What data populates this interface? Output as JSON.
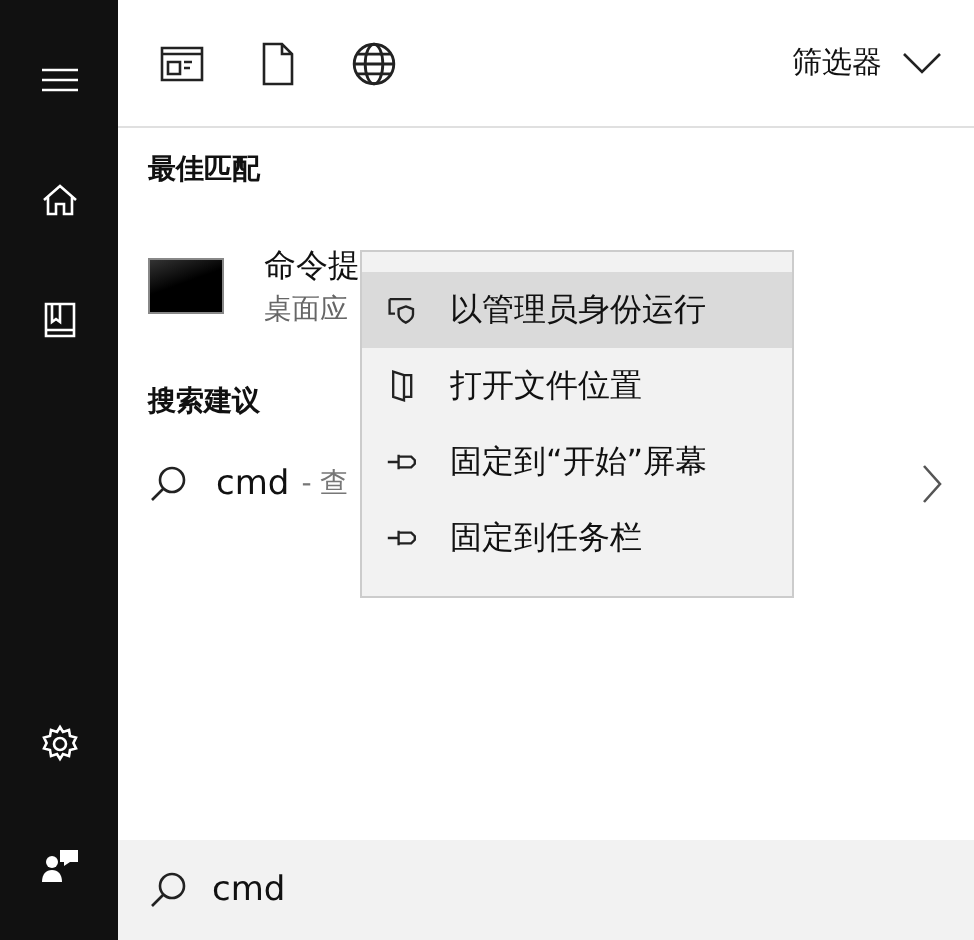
{
  "toolbar": {
    "filter": "筛选器"
  },
  "best_match": {
    "heading": "最佳匹配",
    "title": "命令提",
    "subtitle": "桌面应"
  },
  "suggestions": {
    "heading": "搜索建议",
    "query": "cmd",
    "hint": "- 查"
  },
  "context_menu": [
    {
      "kind": "admin",
      "label": "以管理员身份运行",
      "selected": true
    },
    {
      "kind": "folder",
      "label": "打开文件位置",
      "selected": false
    },
    {
      "kind": "pin",
      "label": "固定到“开始”屏幕",
      "selected": false
    },
    {
      "kind": "pin",
      "label": "固定到任务栏",
      "selected": false
    }
  ],
  "search": {
    "value": "cmd"
  }
}
